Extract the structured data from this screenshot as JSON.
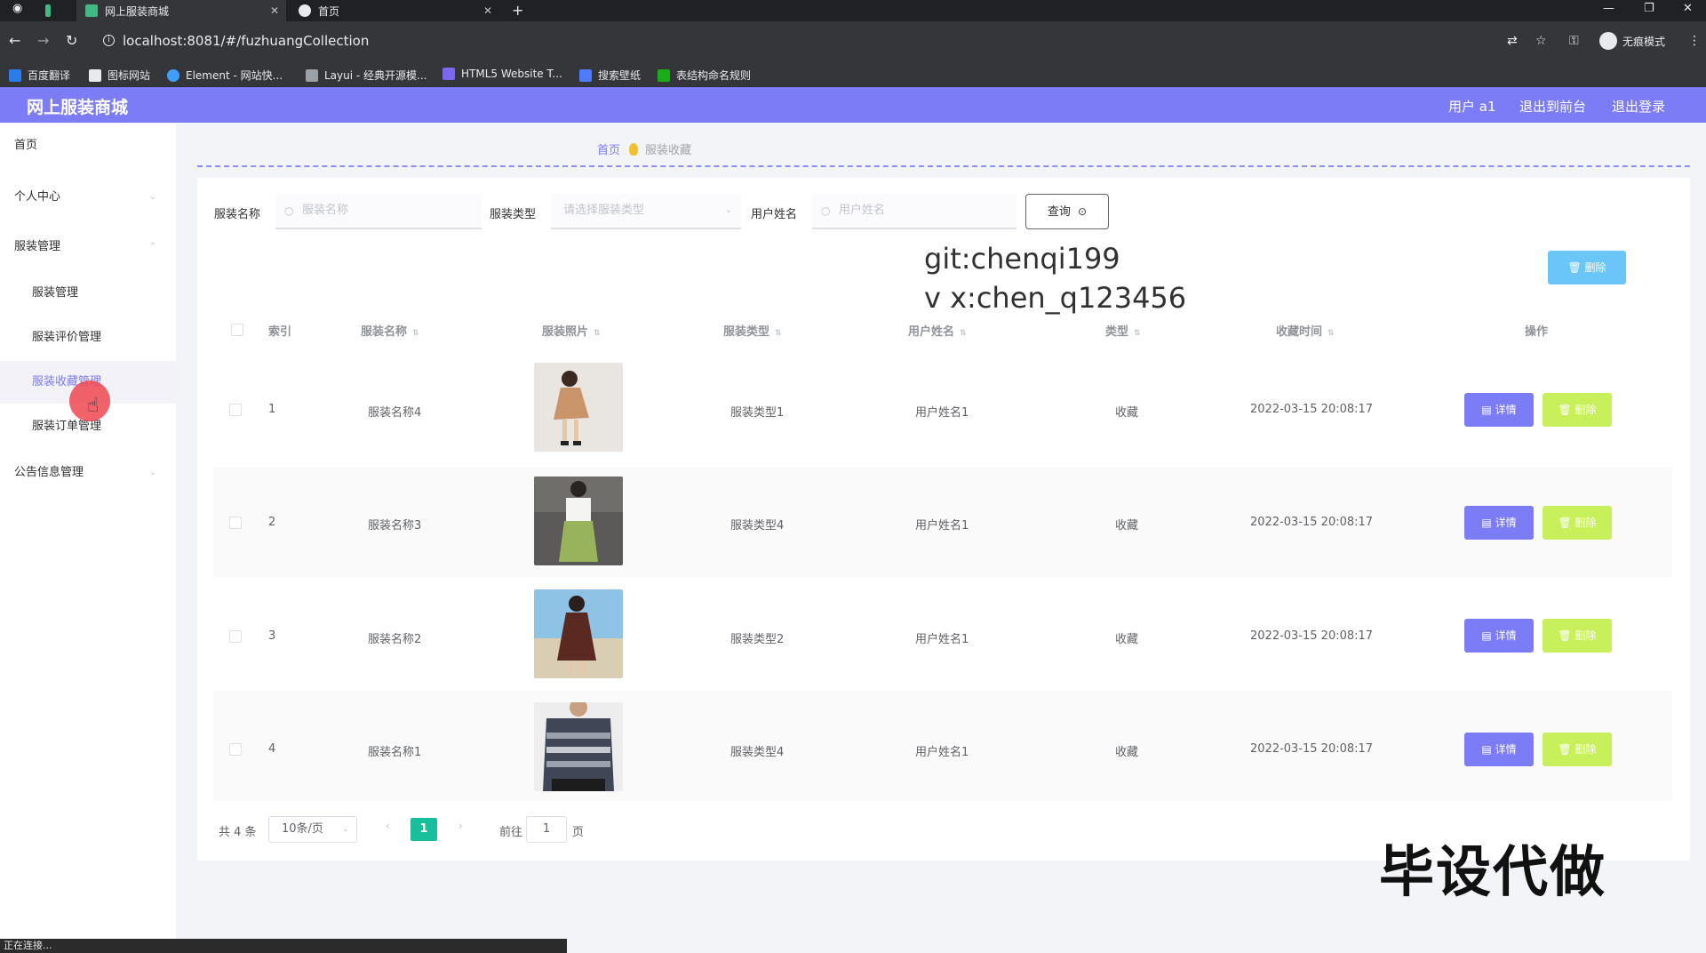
{
  "browser": {
    "tabs": [
      {
        "title": "网上服装商城",
        "active": true
      },
      {
        "title": "首页",
        "active": false
      }
    ],
    "url": "localhost:8081/#/fuzhuangCollection",
    "incognito_label": "无痕模式",
    "bookmarks": [
      "百度翻译",
      "图标网站",
      "Element - 网站快...",
      "Layui - 经典开源模...",
      "HTML5 Website T...",
      "搜索壁纸",
      "表结构命名规则"
    ]
  },
  "header": {
    "title": "网上服装商城",
    "user": "用户 a1",
    "to_front": "退出到前台",
    "logout": "退出登录",
    "color": "#7d7cf7"
  },
  "sidebar": {
    "items": [
      {
        "label": "首页"
      },
      {
        "label": "个人中心"
      },
      {
        "label": "服装管理"
      },
      {
        "label": "服装管理"
      },
      {
        "label": "服装评价管理"
      },
      {
        "label": "服装收藏管理"
      },
      {
        "label": "服装订单管理"
      },
      {
        "label": "公告信息管理"
      }
    ]
  },
  "breadcrumb": {
    "home": "首页",
    "current": "服装收藏"
  },
  "search": {
    "name_label": "服装名称",
    "name_placeholder": "服装名称",
    "type_label": "服装类型",
    "type_placeholder": "请选择服装类型",
    "user_label": "用户姓名",
    "user_placeholder": "用户姓名",
    "query_button": "查询"
  },
  "toolbar": {
    "delete_label": "删除"
  },
  "watermarks": {
    "line1": "git:chenqi199",
    "line2": "v x:chen_q123456",
    "line3": "毕设代做"
  },
  "table": {
    "headers": [
      "索引",
      "服装名称",
      "服装照片",
      "服装类型",
      "用户姓名",
      "类型",
      "收藏时间",
      "操作"
    ],
    "detail_label": "详情",
    "delete_label": "删除",
    "rows": [
      {
        "index": "1",
        "name": "服装名称4",
        "type": "服装类型1",
        "user": "用户姓名1",
        "kind": "收藏",
        "time": "2022-03-15 20:08:17"
      },
      {
        "index": "2",
        "name": "服装名称3",
        "type": "服装类型4",
        "user": "用户姓名1",
        "kind": "收藏",
        "time": "2022-03-15 20:08:17"
      },
      {
        "index": "3",
        "name": "服装名称2",
        "type": "服装类型2",
        "user": "用户姓名1",
        "kind": "收藏",
        "time": "2022-03-15 20:08:17"
      },
      {
        "index": "4",
        "name": "服装名称1",
        "type": "服装类型4",
        "user": "用户姓名1",
        "kind": "收藏",
        "time": "2022-03-15 20:08:17"
      }
    ]
  },
  "pagination": {
    "total": "共 4 条",
    "page_size": "10条/页",
    "current": "1",
    "goto_prefix": "前往",
    "goto_value": "1",
    "goto_suffix": "页"
  },
  "status_text": "正在连接..."
}
